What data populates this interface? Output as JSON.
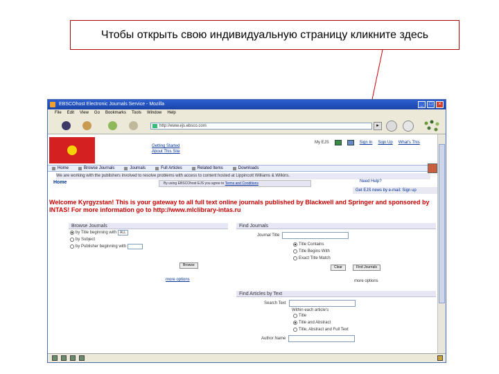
{
  "callout": {
    "text": "Чтобы открыть свою индивидуальную страницу кликните здесь"
  },
  "window": {
    "title": "EBSCOhost Electronic Journals Service - Mozilla",
    "controls": {
      "min": "_",
      "max": "□",
      "close": "×"
    },
    "menu": [
      "File",
      "Edit",
      "View",
      "Go",
      "Bookmarks",
      "Tools",
      "Window",
      "Help"
    ],
    "url": "http://www.ejs.ebsco.com",
    "go": "▸"
  },
  "site": {
    "links_left": [
      "Getting Started",
      "About This Site"
    ],
    "my_ejs": "My EJS",
    "links_top": [
      "Sign In",
      "Sign Up",
      "What's This"
    ],
    "tabs": [
      "Home",
      "Browse Journals",
      "Journals",
      "Full Articles",
      "Related Items",
      "Downloads"
    ],
    "notice": "We are working with the publishers involved to resolve problems with access to content hosted at Lippincott Williams & Wilkins.",
    "home": "Home",
    "terms_prefix": "By using EBSCOhost EJS you agree to",
    "terms_link": "Terms and Conditions",
    "need_help": "Need Help?",
    "ebs_mail": "Get EJS news by e-mail: Sign up",
    "welcome": "Welcome Kyrgyzstan! This is your gateway to all full text online journals published by Blackwell and Springer and sponsored by INTAS! For more information go to http://www.mlclibrary-intas.ru"
  },
  "browse": {
    "header": "Browse Journals",
    "rows": [
      "by Title beginning with",
      "by Subject",
      "by Publisher beginning with"
    ],
    "sel1": "ALL",
    "sel2": "",
    "button": "Browse",
    "more": "more options"
  },
  "find_journals": {
    "header": "Find Journals",
    "title_label": "Journal Title",
    "radios": [
      "Title Contains",
      "Title Begins With",
      "Exact Title Match"
    ],
    "clear": "Clear",
    "find": "Find Journals",
    "more": "more options"
  },
  "find_articles": {
    "header": "Find Articles by Text",
    "search_label": "Search Text",
    "within_label": "Within each article's",
    "radios": [
      "Title",
      "Title and Abstract",
      "Title, Abstract and Full Text"
    ],
    "author_label": "Author Name"
  }
}
